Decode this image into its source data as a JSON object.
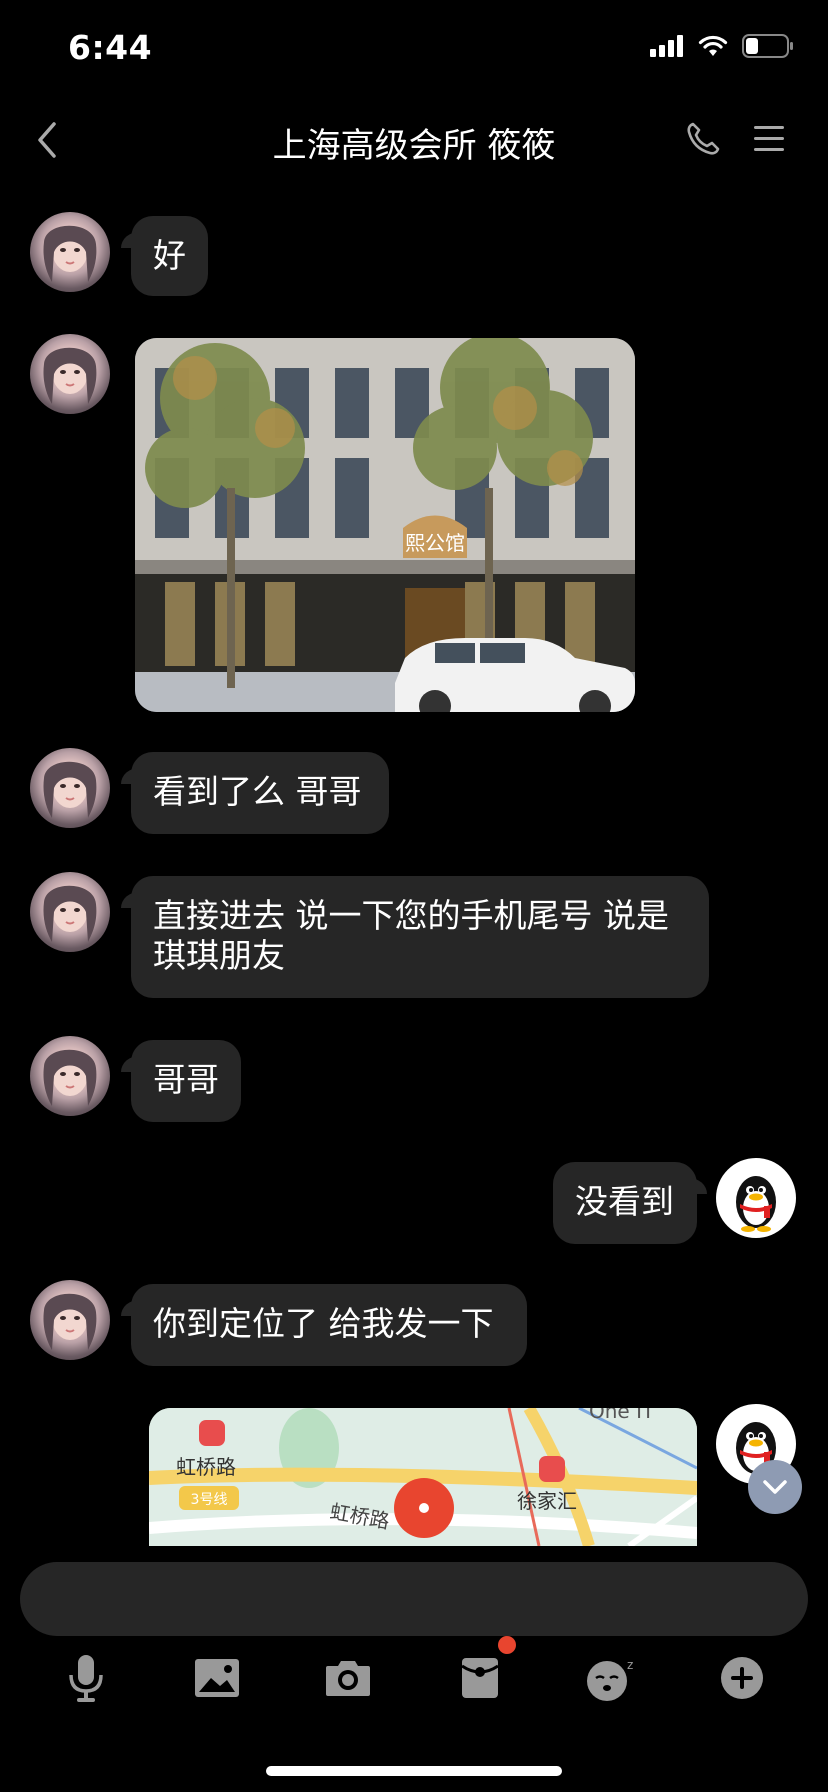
{
  "status_bar": {
    "time": "6:44"
  },
  "header": {
    "title": "上海高级会所 筱筱"
  },
  "messages": [
    {
      "text": "好"
    },
    {
      "text": "看到了么 哥哥"
    },
    {
      "text": "直接进去 说一下您的手机尾号 说是琪琪朋友"
    },
    {
      "text": "哥哥"
    },
    {
      "text": "没看到"
    },
    {
      "text": "你到定位了 给我发一下"
    }
  ],
  "photo": {
    "sign_text": "熙公馆"
  },
  "map": {
    "station_left": "虹桥路",
    "line_badge": "3号线",
    "road_label": "虹桥路",
    "station_right": "徐家汇",
    "top_text": "One IT"
  },
  "toolbar": {
    "icons": [
      "microphone-icon",
      "image-icon",
      "camera-icon",
      "red-packet-icon",
      "emoji-icon",
      "plus-icon"
    ]
  },
  "colors": {
    "bubble": "#262626",
    "accent_red": "#e8452f",
    "background": "#000000"
  }
}
